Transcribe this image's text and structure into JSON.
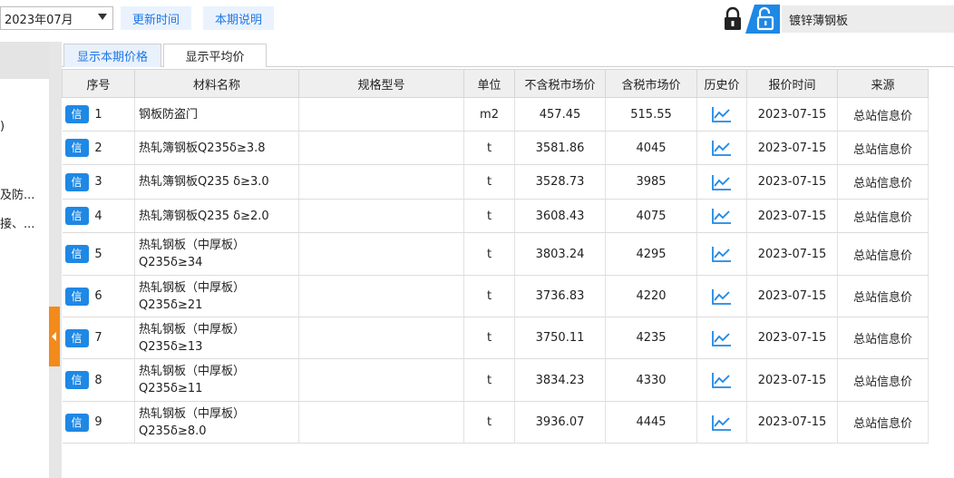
{
  "toolbar": {
    "period_value": "2023年07月",
    "update_label": "更新时间",
    "explain_label": "本期说明",
    "search_value": "镀锌薄钢板"
  },
  "left_panel": {
    "items": [
      ")",
      "及防...",
      "接、..."
    ]
  },
  "tabs": [
    {
      "label": "显示本期价格",
      "active": true
    },
    {
      "label": "显示平均价",
      "active": false
    }
  ],
  "table": {
    "columns": [
      "序号",
      "材料名称",
      "规格型号",
      "单位",
      "不含税市场价",
      "含税市场价",
      "历史价",
      "报价时间",
      "来源"
    ],
    "badge_label": "信",
    "rows": [
      {
        "no": "1",
        "name": [
          "钢板防盗门"
        ],
        "spec": "",
        "unit": "m2",
        "price_ex": "457.45",
        "price_in": "515.55",
        "time": "2023-07-15",
        "source": "总站信息价"
      },
      {
        "no": "2",
        "name": [
          "热轧簿钢板Q235δ≥3.8"
        ],
        "spec": "",
        "unit": "t",
        "price_ex": "3581.86",
        "price_in": "4045",
        "time": "2023-07-15",
        "source": "总站信息价"
      },
      {
        "no": "3",
        "name": [
          "热轧簿钢板Q235 δ≥3.0"
        ],
        "spec": "",
        "unit": "t",
        "price_ex": "3528.73",
        "price_in": "3985",
        "time": "2023-07-15",
        "source": "总站信息价"
      },
      {
        "no": "4",
        "name": [
          "热轧簿钢板Q235 δ≥2.0"
        ],
        "spec": "",
        "unit": "t",
        "price_ex": "3608.43",
        "price_in": "4075",
        "time": "2023-07-15",
        "source": "总站信息价"
      },
      {
        "no": "5",
        "name": [
          "热轧钢板（中厚板）",
          "Q235δ≥34"
        ],
        "spec": "",
        "unit": "t",
        "price_ex": "3803.24",
        "price_in": "4295",
        "time": "2023-07-15",
        "source": "总站信息价"
      },
      {
        "no": "6",
        "name": [
          "热轧钢板（中厚板）",
          "Q235δ≥21"
        ],
        "spec": "",
        "unit": "t",
        "price_ex": "3736.83",
        "price_in": "4220",
        "time": "2023-07-15",
        "source": "总站信息价"
      },
      {
        "no": "7",
        "name": [
          "热轧钢板（中厚板）",
          "Q235δ≥13"
        ],
        "spec": "",
        "unit": "t",
        "price_ex": "3750.11",
        "price_in": "4235",
        "time": "2023-07-15",
        "source": "总站信息价"
      },
      {
        "no": "8",
        "name": [
          "热轧钢板（中厚板）",
          "Q235δ≥11"
        ],
        "spec": "",
        "unit": "t",
        "price_ex": "3834.23",
        "price_in": "4330",
        "time": "2023-07-15",
        "source": "总站信息价"
      },
      {
        "no": "9",
        "name": [
          "热轧钢板（中厚板）",
          "Q235δ≥8.0"
        ],
        "spec": "",
        "unit": "t",
        "price_ex": "3936.07",
        "price_in": "4445",
        "time": "2023-07-15",
        "source": "总站信息价"
      }
    ]
  },
  "icons": {
    "history": "trend-line-chart-icon",
    "lock": "lock-icon",
    "unlock": "unlock-icon",
    "dropdown": "chevron-down-icon"
  },
  "colors": {
    "accent": "#1e78e6",
    "badge": "#1e88e5",
    "handle": "#f28a1c"
  }
}
